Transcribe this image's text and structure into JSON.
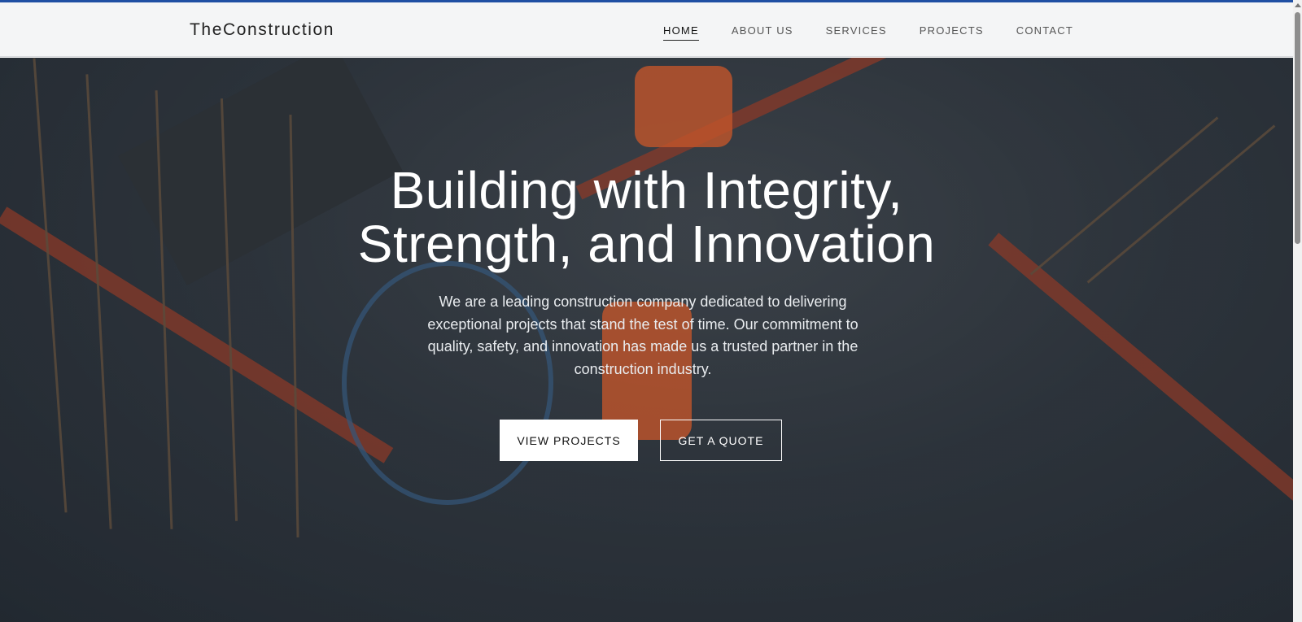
{
  "brand": {
    "name": "TheConstruction"
  },
  "nav": {
    "items": [
      {
        "label": "HOME",
        "active": true
      },
      {
        "label": "ABOUT US",
        "active": false
      },
      {
        "label": "SERVICES",
        "active": false
      },
      {
        "label": "PROJECTS",
        "active": false
      },
      {
        "label": "CONTACT",
        "active": false
      }
    ]
  },
  "hero": {
    "title_line1": "Building with Integrity,",
    "title_line2": "Strength, and Innovation",
    "subtitle": "We are a leading construction company dedicated to delivering exceptional projects that stand the test of time. Our commitment to quality, safety, and innovation has made us a trusted partner in the construction industry.",
    "primary_button": "VIEW PROJECTS",
    "secondary_button": "GET A QUOTE"
  },
  "colors": {
    "accent_bar": "#1f4fa3",
    "navbar_bg": "#f4f5f6",
    "hero_text": "#ffffff"
  }
}
